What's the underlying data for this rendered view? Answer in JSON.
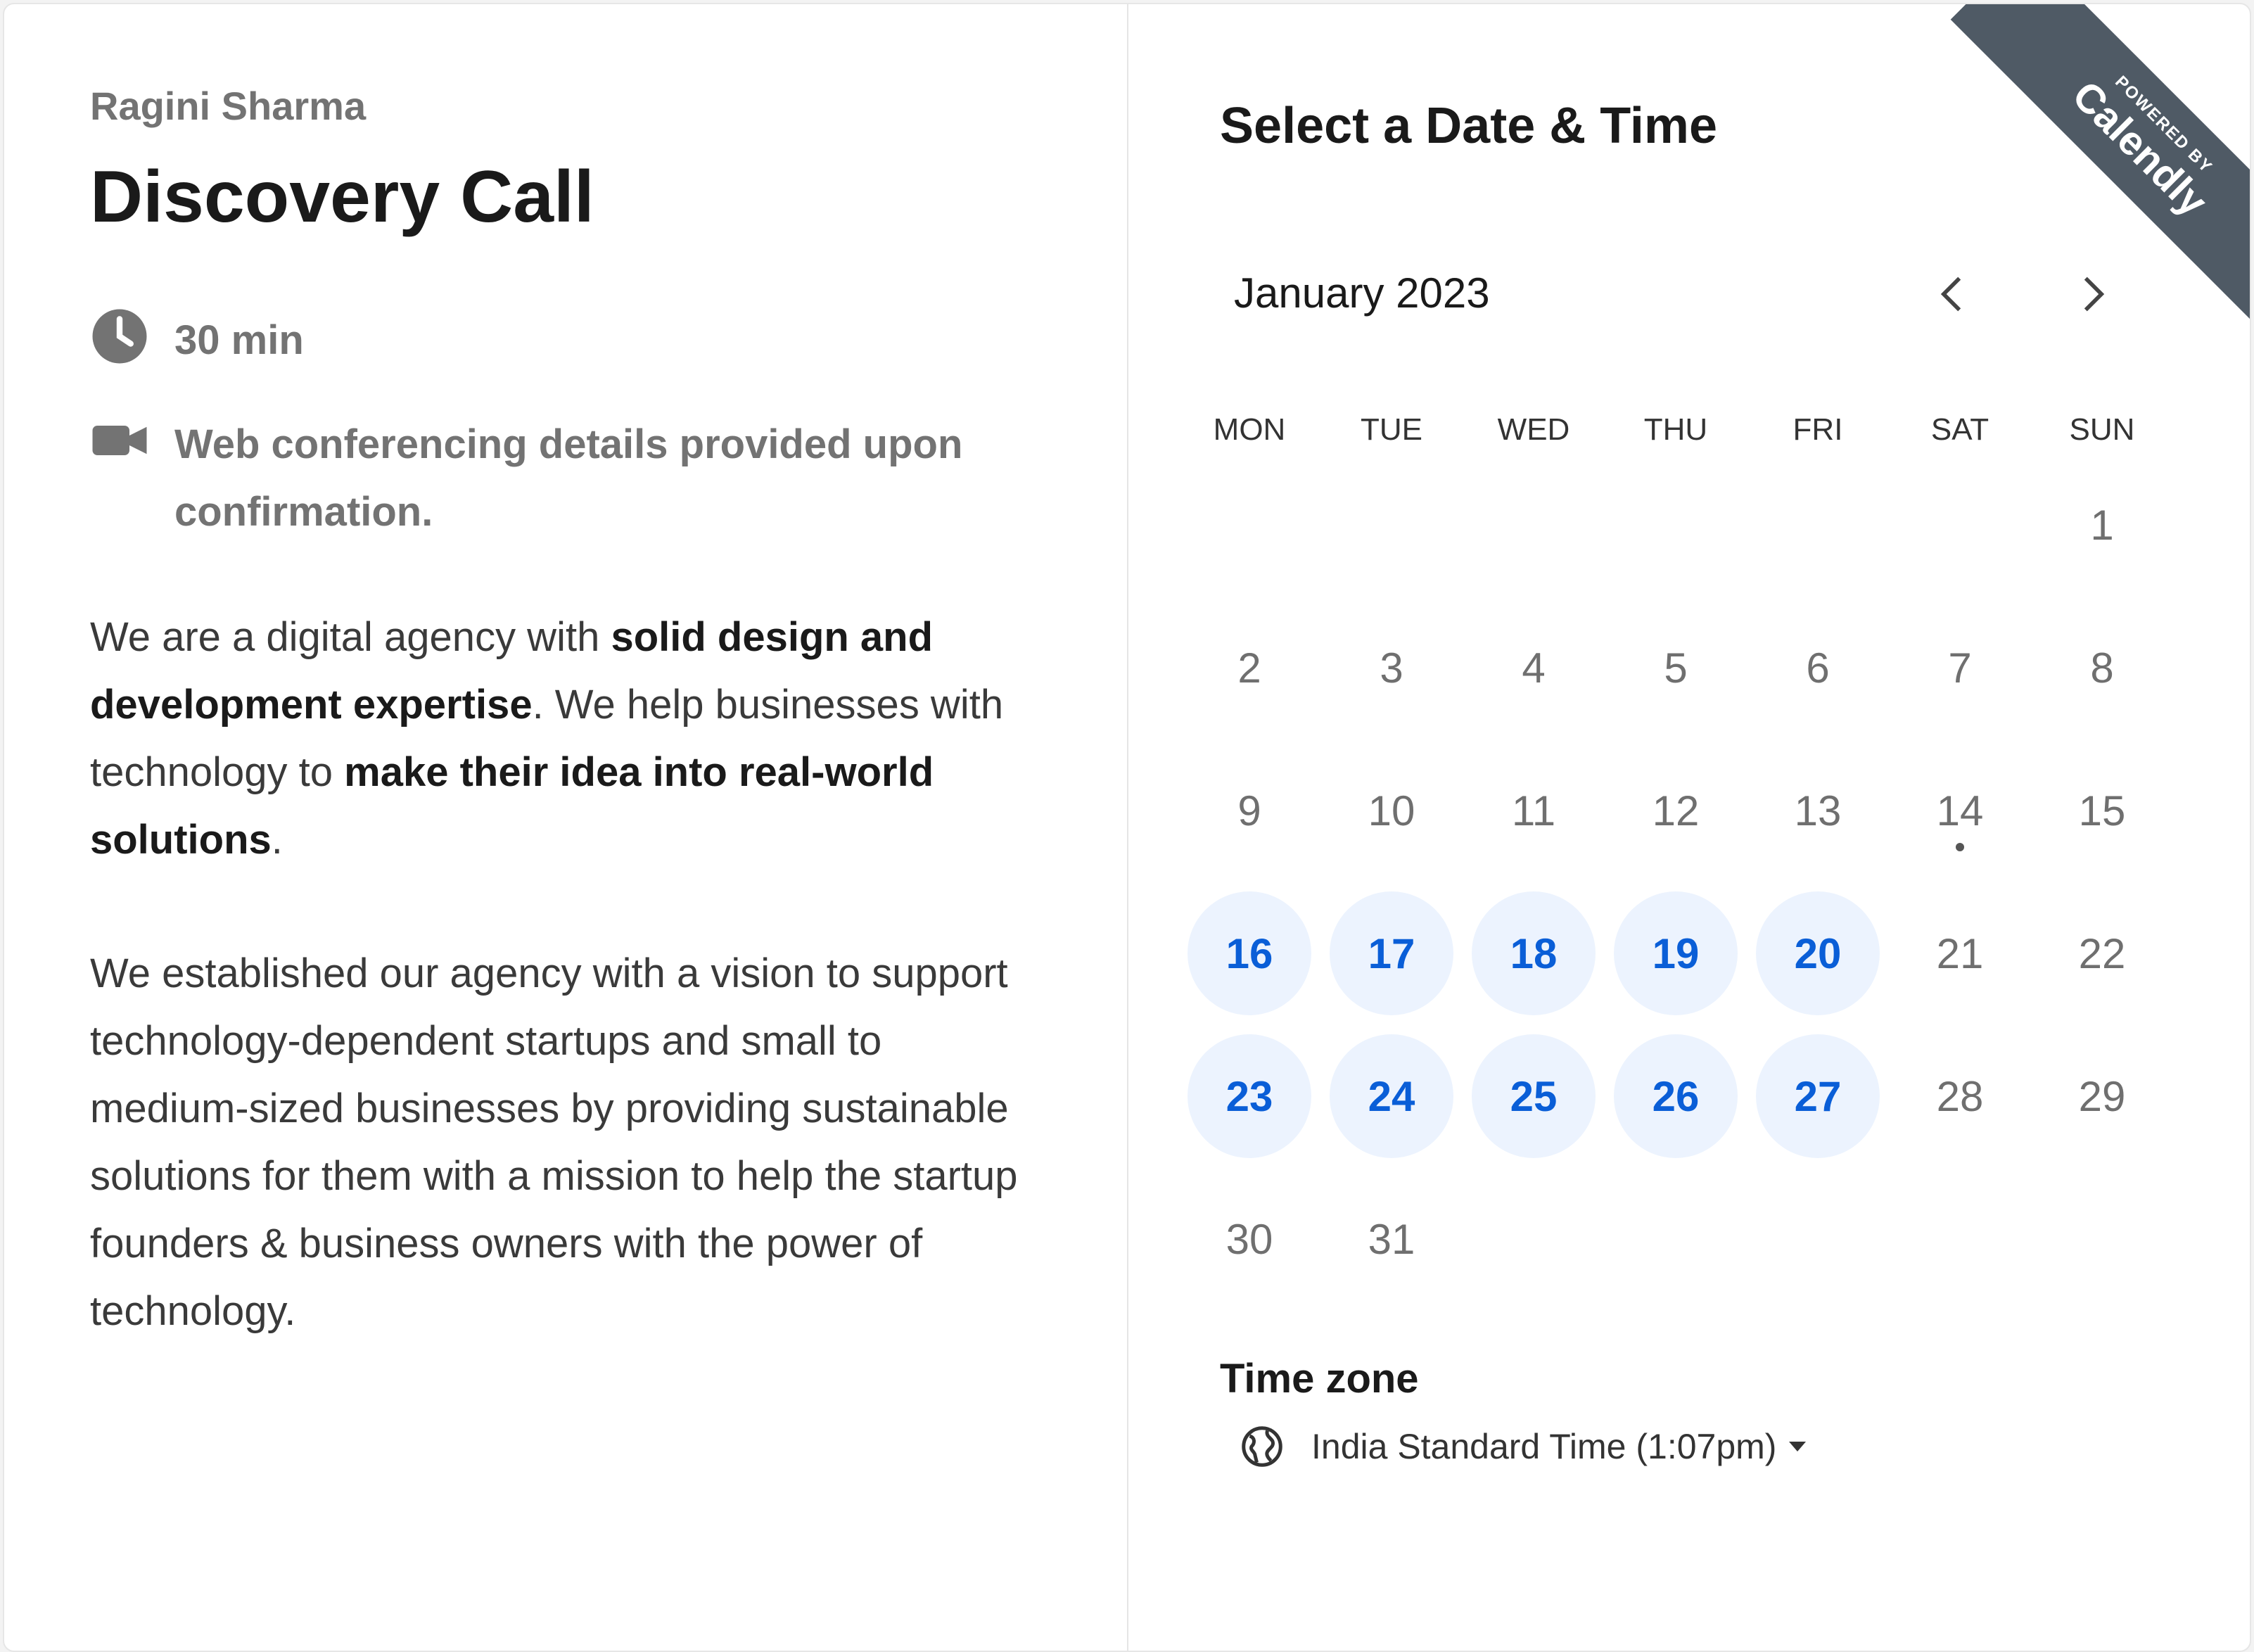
{
  "event": {
    "organizer": "Ragini Sharma",
    "title": "Discovery Call",
    "duration": "30 min",
    "conferencing": "Web conferencing details provided upon confirmation.",
    "description_p1": [
      {
        "text": "We are a digital agency with ",
        "bold": false
      },
      {
        "text": "solid design and development expertise",
        "bold": true
      },
      {
        "text": ". We help businesses with technology to ",
        "bold": false
      },
      {
        "text": "make their idea into real-world solutions",
        "bold": true
      },
      {
        "text": ".",
        "bold": false
      }
    ],
    "description_p2": "We established our agency with a vision to support technology-dependent startups and small to medium-sized businesses by providing sustainable solutions for them with a mission to help the startup founders & business owners with the power of technology."
  },
  "calendar": {
    "heading": "Select a Date & Time",
    "month_label": "January 2023",
    "weekdays": [
      "MON",
      "TUE",
      "WED",
      "THU",
      "FRI",
      "SAT",
      "SUN"
    ],
    "first_weekday_index": 6,
    "days_in_month": 31,
    "today": 14,
    "available_days": [
      16,
      17,
      18,
      19,
      20,
      23,
      24,
      25,
      26,
      27
    ]
  },
  "timezone": {
    "label": "Time zone",
    "value": "India Standard Time (1:07pm)"
  },
  "badge": {
    "small": "POWERED BY",
    "brand": "Calendly"
  },
  "colors": {
    "accent": "#0a5ed7",
    "available_bg": "#ecf3fe",
    "ribbon": "#4f5a65"
  }
}
